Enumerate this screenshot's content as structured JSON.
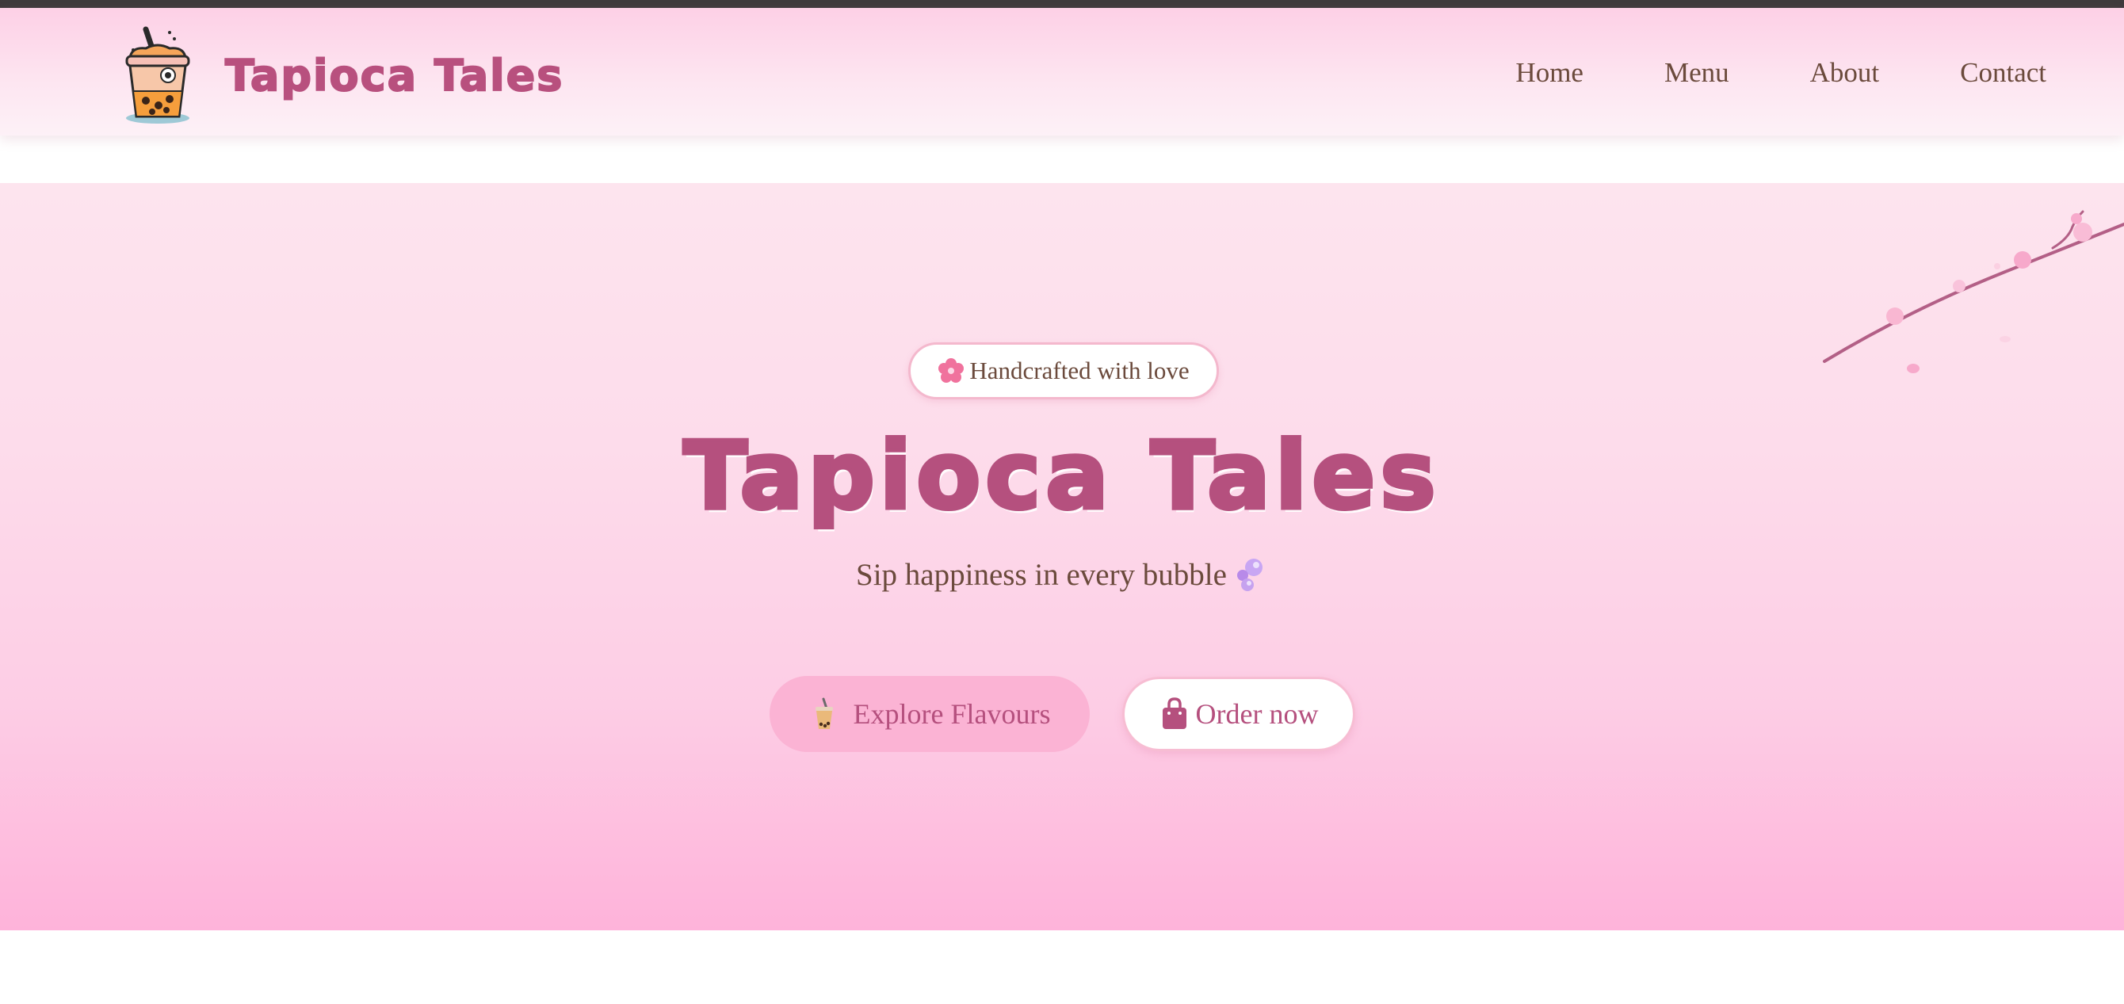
{
  "header": {
    "brand": "Tapioca Tales",
    "nav": [
      {
        "label": "Home"
      },
      {
        "label": "Menu"
      },
      {
        "label": "About"
      },
      {
        "label": "Contact"
      }
    ]
  },
  "hero": {
    "badge": "Handcrafted with love",
    "title": "Tapioca Tales",
    "tagline": "Sip happiness in every bubble",
    "buttons": {
      "explore": "Explore Flavours",
      "order": "Order now"
    }
  },
  "icons": {
    "logo": "boba-cup-icon",
    "badge": "cherry-blossom-icon",
    "tagline": "bubbles-icon",
    "explore": "bubble-tea-icon",
    "order": "shopping-bag-icon",
    "decoration": "cherry-blossom-branch"
  },
  "colors": {
    "brand": "#b5507e",
    "text": "#6b4a3c",
    "hero_top": "#fde4ee",
    "hero_bottom": "#feb3da",
    "explore_button": "#fbb3d4"
  }
}
